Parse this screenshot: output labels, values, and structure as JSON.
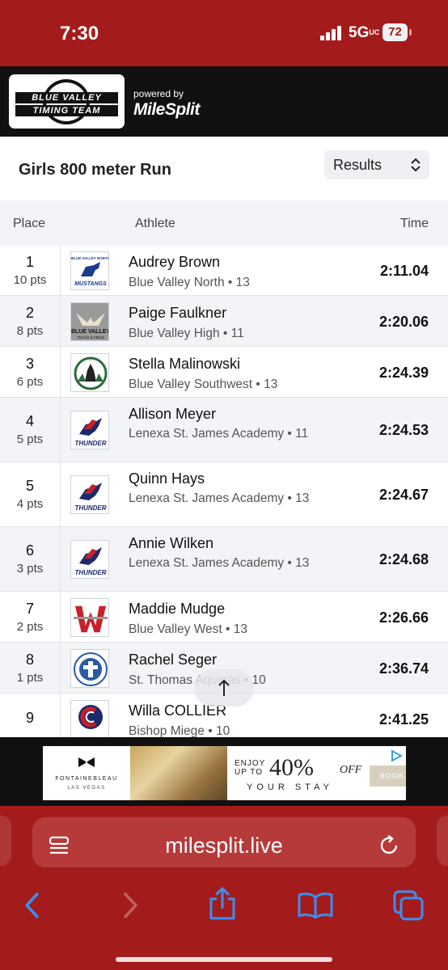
{
  "status_bar": {
    "time": "7:30",
    "network": "5G",
    "network_suffix": "UC",
    "battery": "72"
  },
  "header": {
    "logo_line1": "BLUE VALLEY",
    "logo_line2": "TIMING TEAM",
    "powered_by": "powered by",
    "brand": "MileSplit"
  },
  "page": {
    "title": "Girls 800 meter Run",
    "view_select": "Results"
  },
  "table": {
    "headers": {
      "place": "Place",
      "athlete": "Athlete",
      "time": "Time"
    },
    "rows": [
      {
        "place": "1",
        "points": "10 pts",
        "name": "Audrey Brown",
        "team": "Blue Valley North • 13",
        "time": "2:11.04",
        "logo": "mustangs-logo"
      },
      {
        "place": "2",
        "points": "8 pts",
        "name": "Paige Faulkner",
        "team": "Blue Valley High • 11",
        "time": "2:20.06",
        "logo": "blue-valley-tf-logo"
      },
      {
        "place": "3",
        "points": "6 pts",
        "name": "Stella Malinowski",
        "team": "Blue Valley Southwest • 13",
        "time": "2:24.39",
        "logo": "timberwolves-logo"
      },
      {
        "place": "4",
        "points": "5 pts",
        "name": "Allison Meyer",
        "team": "Lenexa St. James Academy • 11",
        "time": "2:24.53",
        "logo": "thunder-logo"
      },
      {
        "place": "5",
        "points": "4 pts",
        "name": "Quinn Hays",
        "team": "Lenexa St. James Academy • 13",
        "time": "2:24.67",
        "logo": "thunder-logo"
      },
      {
        "place": "6",
        "points": "3 pts",
        "name": "Annie Wilken",
        "team": "Lenexa St. James Academy • 13",
        "time": "2:24.68",
        "logo": "thunder-logo"
      },
      {
        "place": "7",
        "points": "2 pts",
        "name": "Maddie Mudge",
        "team": "Blue Valley West • 13",
        "time": "2:26.66",
        "logo": "bvw-logo"
      },
      {
        "place": "8",
        "points": "1 pts",
        "name": "Rachel Seger",
        "team": "St. Thomas Aquinas • 10",
        "time": "2:36.74",
        "logo": "aquinas-logo"
      },
      {
        "place": "9",
        "points": "",
        "name": "Willa COLLIER",
        "team": "Bishop Miege • 10",
        "time": "2:41.25",
        "logo": "miege-logo"
      }
    ]
  },
  "ad": {
    "brand": "FONTAINEBLEAU",
    "location": "LAS VEGAS",
    "enjoy": "ENJOY",
    "up_to": "UP TO",
    "percent": "40%",
    "off": "OFF",
    "stay": "YOUR STAY",
    "cta": "BOOK NOW"
  },
  "browser": {
    "url": "milesplit.live"
  },
  "colors": {
    "chrome_red": "#a41b1b",
    "header_black": "#111111",
    "row_alt": "#f3f4f7"
  }
}
